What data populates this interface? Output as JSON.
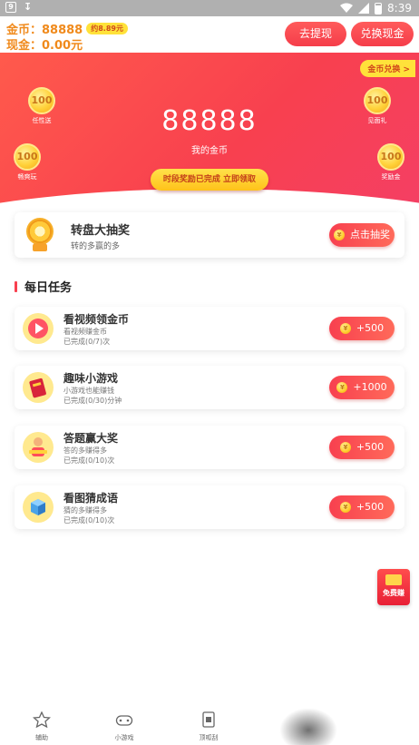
{
  "status_bar": {
    "time": "8:39"
  },
  "header": {
    "coin_text": "金币：88888",
    "approx_value": "约8.89元",
    "cash_text": "现金：0.00元",
    "withdraw_label": "去提现",
    "exchange_cash_label": "兑换现金"
  },
  "hero": {
    "exchange_badge": "金币兑换 >",
    "coin_amount": "88888",
    "coin_label": "我的金币",
    "claim_label": "时段奖励已完成 立即领取",
    "bubbles": [
      {
        "value": "100",
        "label": "任性送"
      },
      {
        "value": "100",
        "label": "畅爽玩"
      },
      {
        "value": "100",
        "label": "见面礼"
      },
      {
        "value": "100",
        "label": "奖励金"
      }
    ]
  },
  "lottery": {
    "title": "转盘大抽奖",
    "subtitle": "转的多赢的多",
    "button_label": "点击抽奖"
  },
  "daily_tasks": {
    "title": "每日任务",
    "items": [
      {
        "title": "看视频领金币",
        "desc": "看视频赚金币",
        "progress": "已完成(0/7)次",
        "reward": "+500"
      },
      {
        "title": "趣味小游戏",
        "desc": "小游戏也能赚钱",
        "progress": "已完成(0/30)分钟",
        "reward": "+1000"
      },
      {
        "title": "答题赢大奖",
        "desc": "答的多赚得多",
        "progress": "已完成(0/10)次",
        "reward": "+500"
      },
      {
        "title": "看图猜成语",
        "desc": "猜的多赚得多",
        "progress": "已完成(0/10)次",
        "reward": "+500"
      }
    ]
  },
  "float_envelope": {
    "label": "免费赚"
  },
  "bottom_nav": {
    "items": [
      {
        "label": "辅助"
      },
      {
        "label": "小游戏"
      },
      {
        "label": "顶呱刮"
      }
    ]
  },
  "colors": {
    "primary_red": "#f8404f",
    "gold": "#ffd23a",
    "coin_orange": "#f08a1c"
  }
}
